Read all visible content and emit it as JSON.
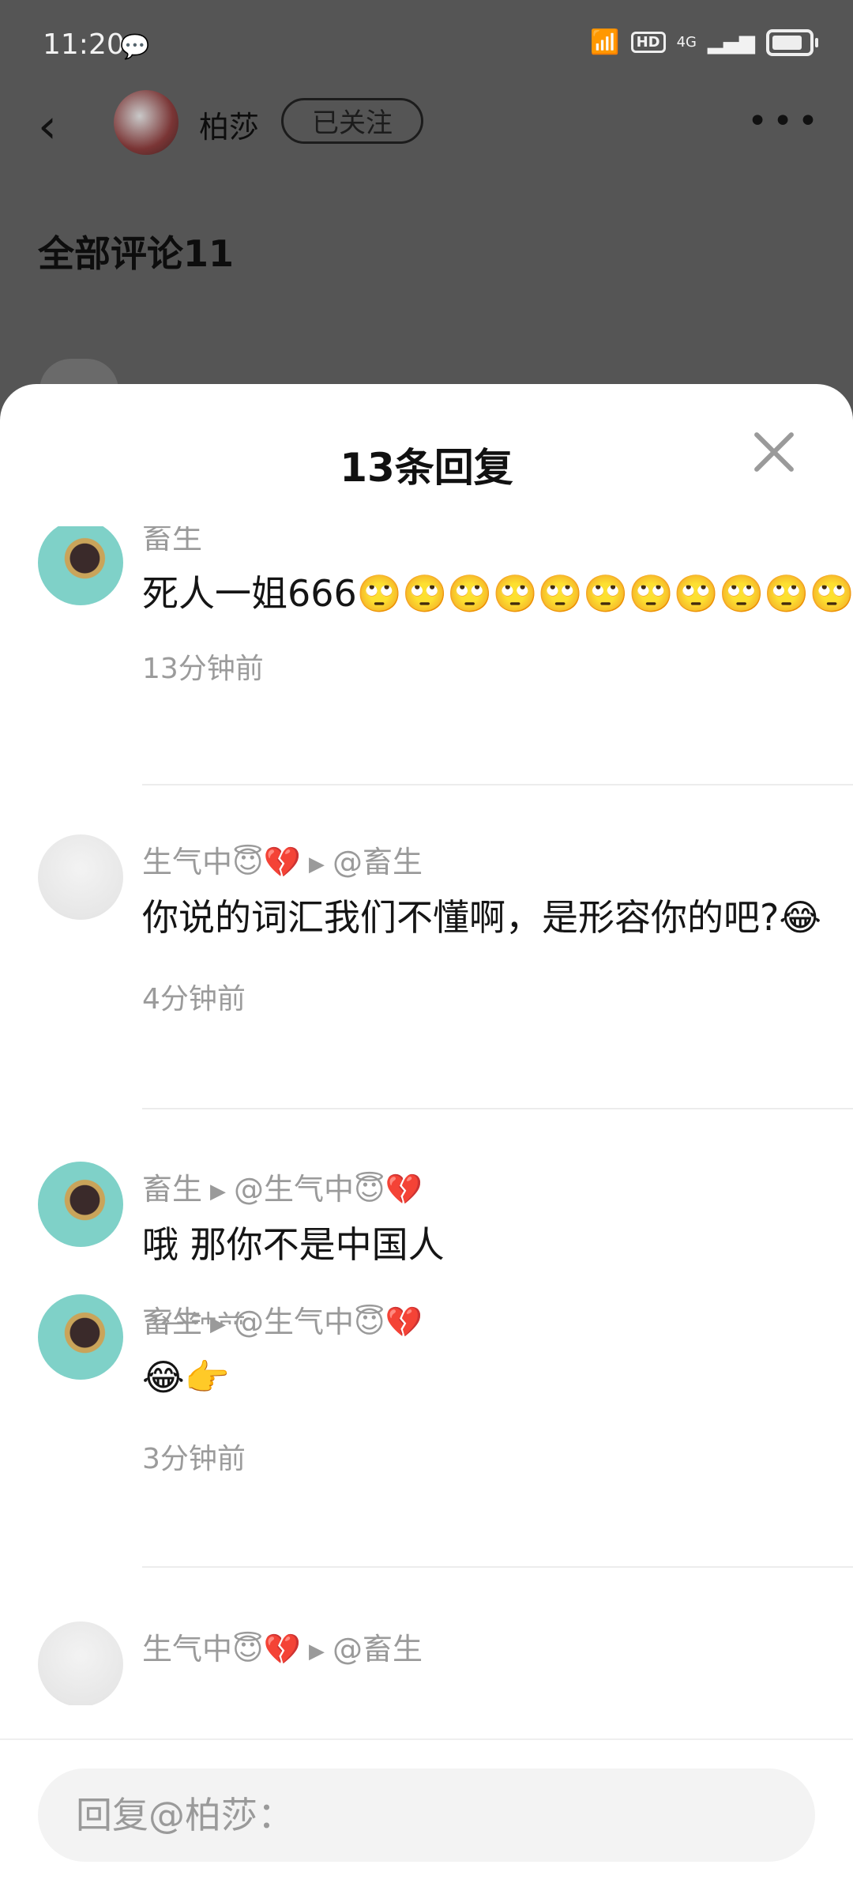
{
  "status_bar": {
    "time": "11:20",
    "wechat_icon": "wechat-icon",
    "hd": "HD",
    "network": "4G",
    "battery_level": 0.85
  },
  "header": {
    "back_icon": "back-arrow-icon",
    "username": "柏莎",
    "follow_label": "已关注",
    "more_icon": "more-icon"
  },
  "background": {
    "all_comments": "全部评论11"
  },
  "sheet": {
    "title": "13条回复",
    "close_icon": "close-icon",
    "replies": [
      {
        "author": "畜生",
        "reply_to": "",
        "content": "死人一姐666🙄🙄🙄🙄🙄🙄🙄🙄🙄🙄🙄",
        "time": "13分钟前"
      },
      {
        "author": "生气中😇💔",
        "reply_to": "@畜生",
        "content": "你说的词汇我们不懂啊，是形容你的吧?😂",
        "time": "4分钟前"
      },
      {
        "author": "畜生",
        "reply_to": "@生气中😇💔",
        "content": "哦 那你不是中国人",
        "time": "3分钟前"
      },
      {
        "author": "畜生",
        "reply_to": "@生气中😇💔",
        "content": "😂👉",
        "time": "3分钟前"
      },
      {
        "author": "生气中😇💔",
        "reply_to": "@畜生",
        "content": "",
        "time": ""
      }
    ],
    "reply_input_placeholder": "回复@柏莎："
  },
  "colors": {
    "overlay": "#555555",
    "sheet_bg": "#ffffff",
    "meta_text": "#9a9a9a",
    "input_bg": "#f3f3f3"
  }
}
